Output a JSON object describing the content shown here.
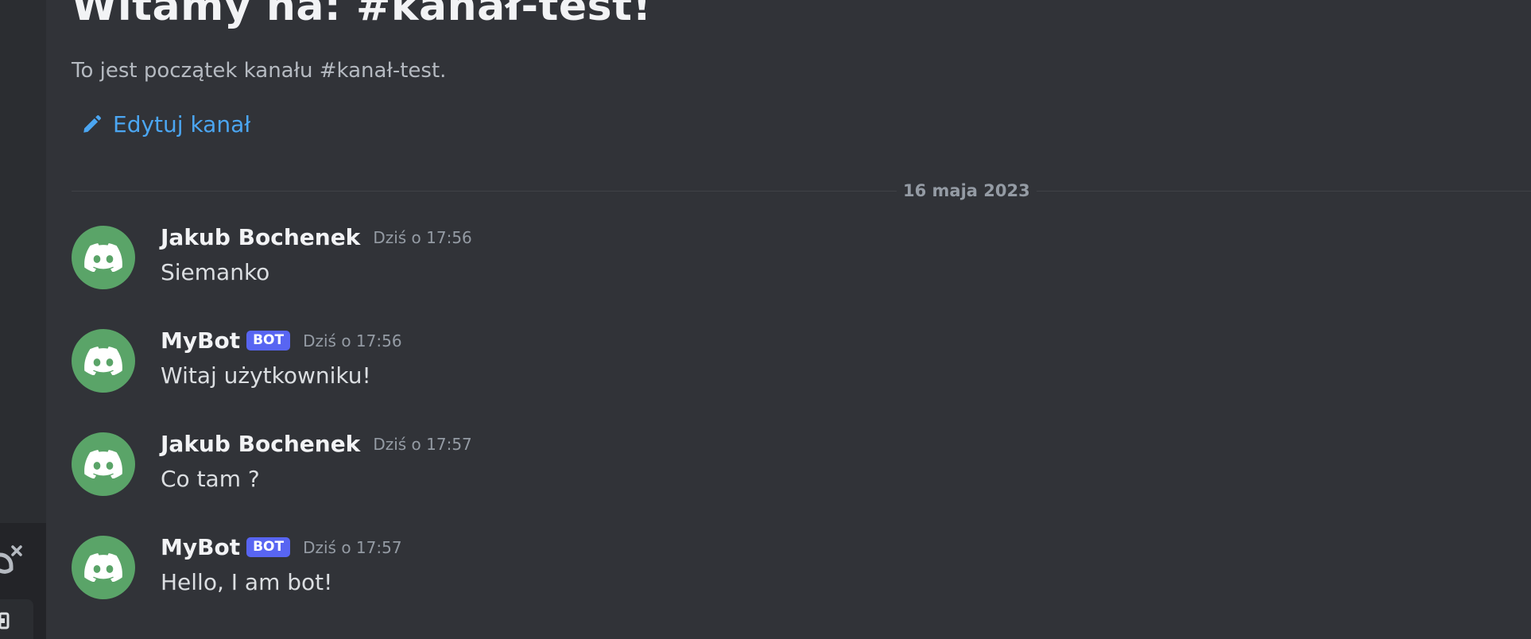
{
  "welcome": {
    "title": "Witamy na: #kanał-test!",
    "subtitle": "To jest początek kanału #kanał-test.",
    "edit_label": "Edytuj kanał"
  },
  "divider": {
    "date": "16 maja 2023"
  },
  "messages": [
    {
      "author": "Jakub Bochenek",
      "bot": false,
      "timestamp": "Dziś o 17:56",
      "content": "Siemanko"
    },
    {
      "author": "MyBot",
      "bot": true,
      "bot_tag": "BOT",
      "timestamp": "Dziś o 17:56",
      "content": "Witaj użytkowniku!"
    },
    {
      "author": "Jakub Bochenek",
      "bot": false,
      "timestamp": "Dziś o 17:57",
      "content": "Co tam ?"
    },
    {
      "author": "MyBot",
      "bot": true,
      "bot_tag": "BOT",
      "timestamp": "Dziś o 17:57",
      "content": "Hello, I am bot!"
    }
  ],
  "colors": {
    "background": "#313338",
    "link": "#4ba6f2",
    "avatar": "#5aa468",
    "bot_tag": "#5865f2"
  },
  "icons": {
    "edit": "pencil-icon",
    "avatar": "discord-logo-icon",
    "disconnect": "phone-disconnect-icon"
  }
}
